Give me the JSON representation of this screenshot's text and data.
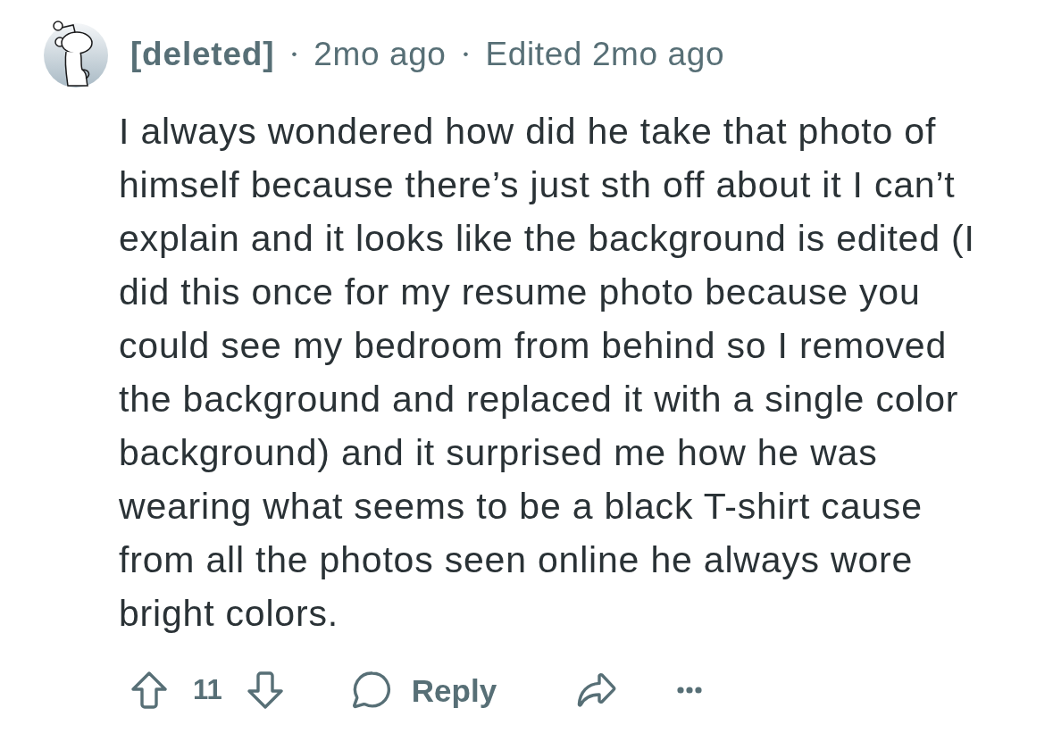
{
  "comment": {
    "meta": [
      {
        "kind": "author",
        "text": "[deleted]"
      },
      {
        "kind": "separator",
        "text": "•"
      },
      {
        "kind": "time",
        "text": "2mo ago"
      },
      {
        "kind": "separator",
        "text": "•"
      },
      {
        "kind": "time",
        "text": "Edited 2mo ago"
      }
    ],
    "body": "I always wondered how did he take that photo of\nhimself because there’s just sth off about it I can’t\nexplain and it looks like the background is edited (I\ndid this once for my resume photo because you\ncould see my bedroom from behind so I removed\nthe background and replaced it with a single color\nbackground) and it surprised me how he was\nwearing what seems to be a black T-shirt cause\nfrom all the photos seen online he always wore\nbright colors.",
    "actions": {
      "votes": "11",
      "reply": "Reply"
    }
  }
}
